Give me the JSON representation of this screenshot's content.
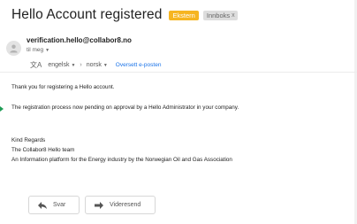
{
  "email": {
    "subject": "Hello Account registered",
    "badges": {
      "external": "Ekstern",
      "inbox": "Innboks",
      "inbox_close": "x"
    },
    "sender": "verification.hello@collabor8.no",
    "to": "til meg"
  },
  "translate": {
    "from_lang": "engelsk",
    "to_lang": "norsk",
    "action": "Oversett e-posten"
  },
  "body": {
    "line1": "Thank you for registering a Hello account.",
    "line2": "The registration process now pending on approval by a Hello Administrator in your company.",
    "sig1": "Kind Regards",
    "sig2": "The Collabor8 Hello team",
    "sig3": "An Information platform for the Energy industry by the Norwegian Oil and Gas Association"
  },
  "actions": {
    "reply": "Svar",
    "forward": "Videresend"
  },
  "colors": {
    "external_badge": "#f6b521",
    "link": "#1a73e8",
    "marker": "#1e9c55"
  },
  "icons": [
    "person-icon",
    "translate-icon",
    "reply-icon",
    "forward-icon",
    "chevron-down-icon"
  ]
}
